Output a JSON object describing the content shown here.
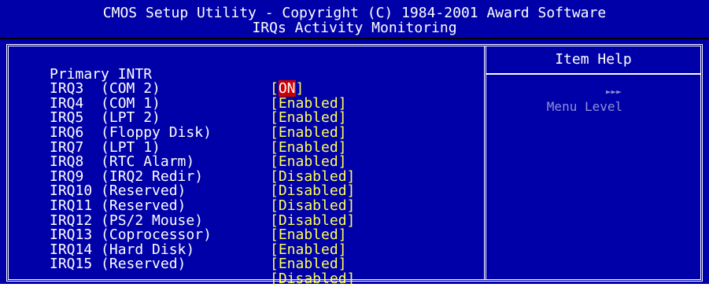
{
  "header": {
    "title": "CMOS Setup Utility - Copyright (C) 1984-2001 Award Software",
    "subtitle": "IRQs Activity Monitoring"
  },
  "colors": {
    "background": "#0000a8",
    "text": "#ffffff",
    "value": "#ffff55",
    "highlight": "#cc0000",
    "dim_text": "#8f8fd6"
  },
  "settings": [
    {
      "label": "Primary INTR",
      "value_open": "[",
      "value_hl": "ON",
      "value_close": "]"
    },
    {
      "label": "IRQ3  (COM 2)",
      "value": "[Enabled]"
    },
    {
      "label": "IRQ4  (COM 1)",
      "value": "[Enabled]"
    },
    {
      "label": "IRQ5  (LPT 2)",
      "value": "[Enabled]"
    },
    {
      "label": "IRQ6  (Floppy Disk)",
      "value": "[Enabled]"
    },
    {
      "label": "IRQ7  (LPT 1)",
      "value": "[Enabled]"
    },
    {
      "label": "IRQ8  (RTC Alarm)",
      "value": "[Disabled]"
    },
    {
      "label": "IRQ9  (IRQ2 Redir)",
      "value": "[Disabled]"
    },
    {
      "label": "IRQ10 (Reserved)",
      "value": "[Disabled]"
    },
    {
      "label": "IRQ11 (Reserved)",
      "value": "[Disabled]"
    },
    {
      "label": "IRQ12 (PS/2 Mouse)",
      "value": "[Enabled]"
    },
    {
      "label": "IRQ13 (Coprocessor)",
      "value": "[Enabled]"
    },
    {
      "label": "IRQ14 (Hard Disk)",
      "value": "[Enabled]"
    },
    {
      "label": "IRQ15 (Reserved)",
      "value": "[Disabled]"
    }
  ],
  "help": {
    "title": "Item Help",
    "menu_level_label": "Menu Level",
    "menu_level_arrows": "►►►"
  }
}
